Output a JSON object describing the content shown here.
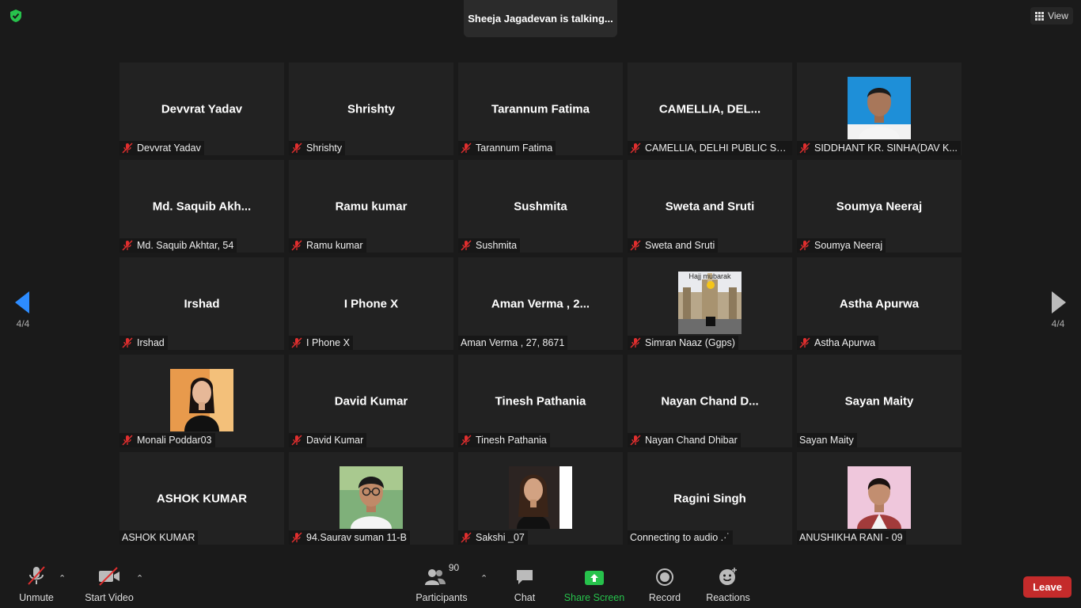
{
  "talking_banner": "Sheeja Jagadevan is talking...",
  "view_button": "View",
  "page_indicator_left": "4/4",
  "page_indicator_right": "4/4",
  "tiles": [
    {
      "big": "Devvrat Yadav",
      "name": "Devvrat Yadav",
      "muted": true
    },
    {
      "big": "Shrishty",
      "name": "Shrishty",
      "muted": true
    },
    {
      "big": "Tarannum Fatima",
      "name": "Tarannum Fatima",
      "muted": true
    },
    {
      "big": "CAMELLIA,  DEL...",
      "name": "CAMELLIA, DELHI PUBLIC SCH...",
      "muted": true
    },
    {
      "big": "",
      "name": "SIDDHANT KR. SINHA(DAV K...",
      "muted": true,
      "photo": "photo-boy-blue-bg"
    },
    {
      "big": "Md.  Saquib  Akh...",
      "name": "Md. Saquib Akhtar, 54",
      "muted": true
    },
    {
      "big": "Ramu kumar",
      "name": "Ramu kumar",
      "muted": true
    },
    {
      "big": "Sushmita",
      "name": "Sushmita",
      "muted": true
    },
    {
      "big": "Sweta and Sruti",
      "name": "Sweta and Sruti",
      "muted": true
    },
    {
      "big": "Soumya Neeraj",
      "name": "Soumya Neeraj",
      "muted": true
    },
    {
      "big": "Irshad",
      "name": "Irshad",
      "muted": true
    },
    {
      "big": "I Phone X",
      "name": "I Phone X",
      "muted": true
    },
    {
      "big": "Aman Verma , 2...",
      "name": "Aman Verma , 27, 8671",
      "muted": false
    },
    {
      "big": "",
      "name": "Simran Naaz (Ggps)",
      "muted": true,
      "photo": "photo-hajj-mubarak",
      "photo_caption": "Hajj mubarak"
    },
    {
      "big": "Astha Apurwa",
      "name": "Astha Apurwa",
      "muted": true
    },
    {
      "big": "",
      "name": "Monali Poddar03",
      "muted": true,
      "photo": "photo-girl-orange-bg"
    },
    {
      "big": "David Kumar",
      "name": "David Kumar",
      "muted": true
    },
    {
      "big": "Tinesh Pathania",
      "name": "Tinesh Pathania",
      "muted": true
    },
    {
      "big": "Nayan  Chand  D...",
      "name": "Nayan Chand Dhibar",
      "muted": true
    },
    {
      "big": "Sayan Maity",
      "name": "Sayan Maity",
      "muted": false
    },
    {
      "big": "ASHOK KUMAR",
      "name": "ASHOK KUMAR",
      "muted": false
    },
    {
      "big": "",
      "name": "94.Saurav suman 11-B",
      "muted": true,
      "photo": "photo-boy-glasses"
    },
    {
      "big": "",
      "name": "Sakshi _07",
      "muted": true,
      "photo": "photo-girl-dark"
    },
    {
      "big": "Ragini Singh",
      "name": "Connecting to audio .·˙",
      "muted": false
    },
    {
      "big": "",
      "name": "ANUSHIKHA RANI - 09",
      "muted": false,
      "photo": "photo-girl-pink"
    }
  ],
  "toolbar": {
    "unmute": "Unmute",
    "start_video": "Start Video",
    "participants": "Participants",
    "participants_count": "90",
    "chat": "Chat",
    "share_screen": "Share Screen",
    "record": "Record",
    "reactions": "Reactions",
    "leave": "Leave"
  },
  "colors": {
    "background": "#1a1a1a",
    "tile": "#222222",
    "leave": "#c42b2b",
    "share": "#27c24c",
    "mute_red": "#e02e2e",
    "nav_arrow": "#2d8cff"
  }
}
